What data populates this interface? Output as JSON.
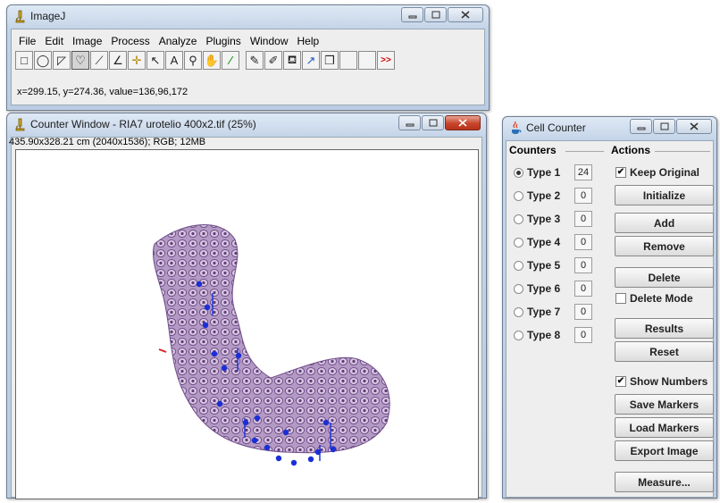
{
  "imagej": {
    "title": "ImageJ",
    "menu": [
      "File",
      "Edit",
      "Image",
      "Process",
      "Analyze",
      "Plugins",
      "Window",
      "Help"
    ],
    "tools": [
      {
        "name": "rectangle-tool-icon",
        "glyph": "□"
      },
      {
        "name": "oval-tool-icon",
        "glyph": "◯"
      },
      {
        "name": "polygon-tool-icon",
        "glyph": "◸"
      },
      {
        "name": "freehand-tool-icon",
        "glyph": "♡"
      },
      {
        "name": "line-tool-icon",
        "glyph": "⟋"
      },
      {
        "name": "angle-tool-icon",
        "glyph": "∠"
      },
      {
        "name": "point-tool-icon",
        "glyph": "✛"
      },
      {
        "name": "wand-tool-icon",
        "glyph": "↖"
      },
      {
        "name": "text-tool-icon",
        "glyph": "A"
      },
      {
        "name": "magnifier-tool-icon",
        "glyph": "⚲"
      },
      {
        "name": "hand-tool-icon",
        "glyph": "✋"
      },
      {
        "name": "dropper-tool-icon",
        "glyph": "⁄"
      },
      {
        "name": "pencil-tool-icon",
        "glyph": "✎"
      },
      {
        "name": "brush-tool-icon",
        "glyph": "✐"
      },
      {
        "name": "flood-fill-tool-icon",
        "glyph": "⛾"
      },
      {
        "name": "arrow-tool-icon",
        "glyph": "↗"
      },
      {
        "name": "developer-menu-icon",
        "glyph": "❐"
      },
      {
        "name": "blank-tool-1-icon",
        "glyph": ""
      },
      {
        "name": "blank-tool-2-icon",
        "glyph": ""
      },
      {
        "name": "more-tools-icon",
        "glyph": ">>"
      }
    ],
    "status": "x=299.15, y=274.36, value=136,96,172"
  },
  "counter_window": {
    "title": "Counter Window - RIA7 urotelio 400x2.tif (25%)",
    "info": "435.90x328.21 cm (2040x1536); RGB; 12MB"
  },
  "cell_counter": {
    "title": "Cell Counter",
    "counters_label": "Counters",
    "actions_label": "Actions",
    "counters": [
      {
        "label": "Type 1",
        "count": "24",
        "selected": true
      },
      {
        "label": "Type 2",
        "count": "0",
        "selected": false
      },
      {
        "label": "Type 3",
        "count": "0",
        "selected": false
      },
      {
        "label": "Type 4",
        "count": "0",
        "selected": false
      },
      {
        "label": "Type 5",
        "count": "0",
        "selected": false
      },
      {
        "label": "Type 6",
        "count": "0",
        "selected": false
      },
      {
        "label": "Type 7",
        "count": "0",
        "selected": false
      },
      {
        "label": "Type 8",
        "count": "0",
        "selected": false
      }
    ],
    "keep_original": {
      "label": "Keep Original",
      "checked": true
    },
    "delete_mode": {
      "label": "Delete Mode",
      "checked": false
    },
    "show_numbers": {
      "label": "Show Numbers",
      "checked": true
    },
    "buttons": {
      "initialize": "Initialize",
      "add": "Add",
      "remove": "Remove",
      "delete": "Delete",
      "results": "Results",
      "reset": "Reset",
      "save_markers": "Save Markers",
      "load_markers": "Load Markers",
      "export_image": "Export Image",
      "measure": "Measure..."
    }
  },
  "colors": {
    "marker": "#1a2fd6",
    "tissue": "#9b76b0",
    "close_red": "#c7452b"
  }
}
